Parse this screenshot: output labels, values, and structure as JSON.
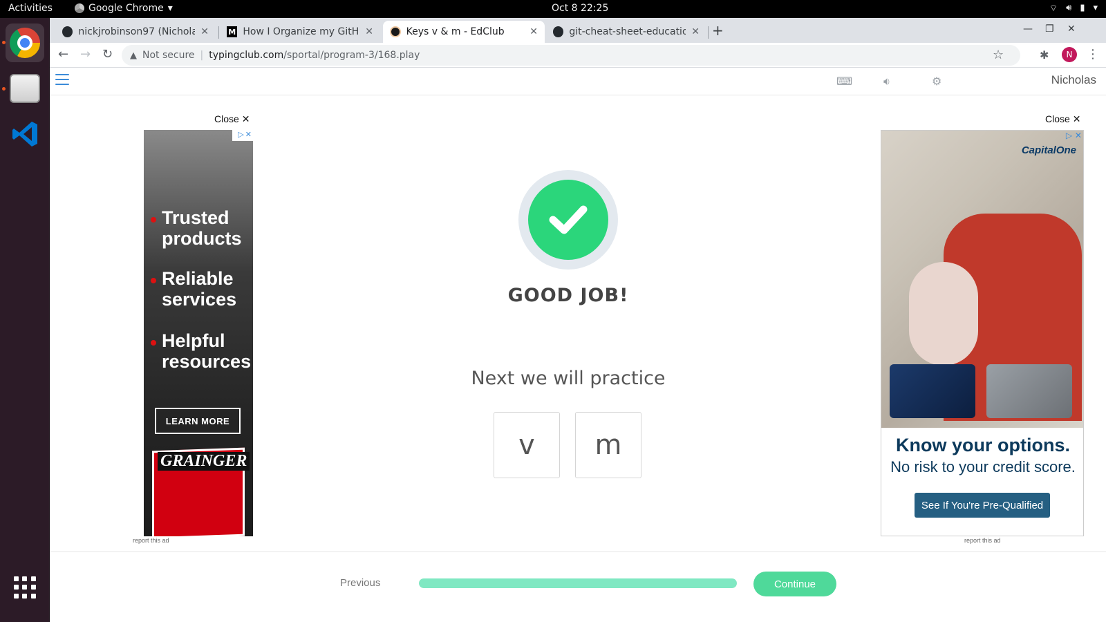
{
  "topbar": {
    "activities": "Activities",
    "app_name": "Google Chrome",
    "clock": "Oct 8  22:25"
  },
  "tabs": [
    {
      "title": "nickjrobinson97 (Nicholas",
      "icon": "github-icon"
    },
    {
      "title": "How I Organize my GitHub",
      "icon": "medium-icon"
    },
    {
      "title": "Keys v & m - EdClub",
      "icon": "edclub-icon",
      "active": true
    },
    {
      "title": "git-cheat-sheet-education",
      "icon": "github-icon"
    }
  ],
  "omnibox": {
    "security": "Not secure",
    "host": "typingclub.com",
    "path": "/sportal/program-3/168.play"
  },
  "profile_initial": "N",
  "site": {
    "username": "Nicholas"
  },
  "ads": {
    "close_label": "Close",
    "report_label": "report this ad",
    "left": {
      "bullets": [
        "Trusted products",
        "Reliable services",
        "Helpful resources"
      ],
      "cta": "LEARN MORE",
      "brand": "GRAINGER"
    },
    "right": {
      "brand": "CapitalOne",
      "headline": "Know your options.",
      "subline": "No risk to your credit score.",
      "cta": "See If You're Pre-Qualified"
    }
  },
  "lesson": {
    "result": "GOOD JOB!",
    "next_label": "Next we will practice",
    "keys": [
      "v",
      "m"
    ]
  },
  "bottom": {
    "previous": "Previous",
    "continue": "Continue",
    "progress_fraction": 1.0
  },
  "colors": {
    "success": "#2bd67b",
    "progress": "#7fe8c2",
    "continue": "#4fd99a"
  }
}
